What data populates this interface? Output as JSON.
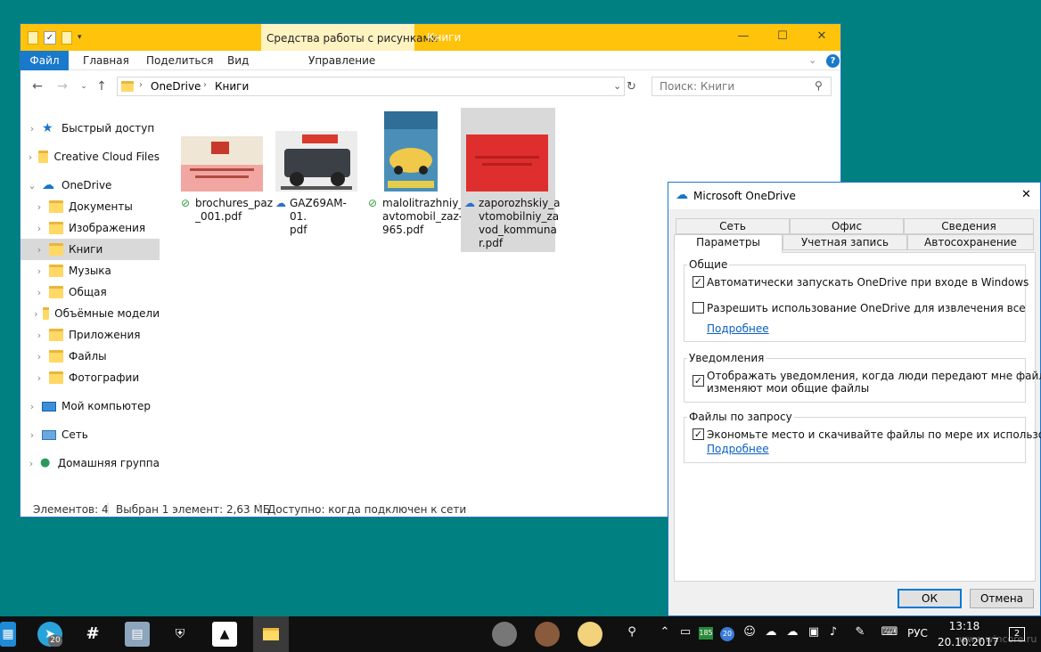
{
  "explorer": {
    "context_tab": "Средства работы с рисунками",
    "window_title": "Книги",
    "ribbon_tabs": [
      "Файл",
      "Главная",
      "Поделиться",
      "Вид",
      "Управление"
    ],
    "breadcrumb": [
      "OneDrive",
      "Книги"
    ],
    "search_placeholder": "Поиск: Книги",
    "nav": [
      {
        "label": "Быстрый доступ",
        "icon": "star-icon"
      },
      {
        "label": "Creative Cloud Files",
        "icon": "folder-icon"
      },
      {
        "label": "OneDrive",
        "icon": "cloud-icon"
      },
      {
        "label": "Документы",
        "icon": "folder-icon"
      },
      {
        "label": "Изображения",
        "icon": "folder-icon"
      },
      {
        "label": "Книги",
        "icon": "folder-icon",
        "selected": true
      },
      {
        "label": "Музыка",
        "icon": "folder-icon"
      },
      {
        "label": "Общая",
        "icon": "folder-icon"
      },
      {
        "label": "Объёмные модели",
        "icon": "folder-icon"
      },
      {
        "label": "Приложения",
        "icon": "folder-icon"
      },
      {
        "label": "Файлы",
        "icon": "folder-icon"
      },
      {
        "label": "Фотографии",
        "icon": "folder-icon"
      },
      {
        "label": "Мой компьютер",
        "icon": "computer-icon"
      },
      {
        "label": "Сеть",
        "icon": "network-icon"
      },
      {
        "label": "Домашняя группа",
        "icon": "homegroup-icon"
      }
    ],
    "files": [
      {
        "line1": "brochures_paz",
        "line2": "_001.pdf",
        "line3": "",
        "line4": "",
        "status": "synced",
        "status_icon": "check-circle-icon"
      },
      {
        "line1": "GAZ69AM-01.",
        "line2": "pdf",
        "line3": "",
        "line4": "",
        "status": "online-only",
        "status_icon": "cloud-outline-icon"
      },
      {
        "line1": "malolitrazhniy_",
        "line2": "avtomobil_zaz-",
        "line3": "965.pdf",
        "line4": "",
        "status": "synced",
        "status_icon": "check-circle-icon"
      },
      {
        "line1": "zaporozhskiy_a",
        "line2": "vtomobilniy_za",
        "line3": "vod_kommuna",
        "line4": "r.pdf",
        "status": "online-only",
        "status_icon": "cloud-outline-icon"
      }
    ],
    "status": {
      "count": "Элементов: 4",
      "selected": "Выбран 1 элемент: 2,63 МБ",
      "availability": "Доступно: когда подключен к сети"
    }
  },
  "dialog": {
    "title": "Microsoft OneDrive",
    "tabs_row1": [
      "Сеть",
      "Офис",
      "Сведения"
    ],
    "tabs_row2": [
      "Параметры",
      "Учетная запись",
      "Автосохранение"
    ],
    "groups": {
      "general": {
        "label": "Общие",
        "opt1": "Автоматически запускать OneDrive при входе в Windows",
        "opt2": "Разрешить использование OneDrive для извлечения всех моих файлов",
        "more": "Подробнее"
      },
      "notifications": {
        "label": "Уведомления",
        "opt1_line1": "Отображать уведомления, когда люди передают мне файлы или",
        "opt1_line2": "изменяют мои общие файлы"
      },
      "files_on_demand": {
        "label": "Файлы по запросу",
        "opt1": "Экономьте место и скачивайте файлы по мере их использования",
        "more": "Подробнее"
      }
    },
    "ok": "ОК",
    "cancel": "Отмена"
  },
  "taskbar": {
    "badge_telegram": "20",
    "badge_counter": "185",
    "badge_mail": "20",
    "lang": "РУС",
    "time": "13:18",
    "date": "20.10.2017",
    "notifications": "2",
    "watermark": "www.wincore.ru"
  },
  "colors": {
    "titlebar": "#ffc30b",
    "accent": "#1979ca",
    "desktop": "#008080"
  }
}
